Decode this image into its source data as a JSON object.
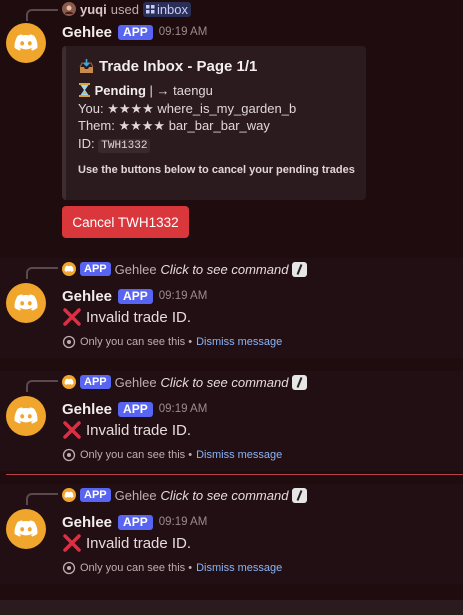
{
  "msg1": {
    "reply_user": "yuqi",
    "reply_action": "used",
    "reply_command": "inbox",
    "author": "Gehlee",
    "badge": "APP",
    "time": "09:19 AM",
    "embed": {
      "title": "Trade Inbox - Page 1/1",
      "status_label": "Pending",
      "status_sep": "| → taengu",
      "you_label": "You:",
      "you_value": "★★★★ where_is_my_garden_b",
      "them_label": "Them:",
      "them_value": "★★★★ bar_bar_bar_way",
      "id_label": "ID:",
      "id_value": "TWH1332",
      "footer": "Use the buttons below to cancel your pending trades"
    },
    "button": "Cancel TWH1332"
  },
  "ephemeral": {
    "reply_badge": "APP",
    "reply_author": "Gehlee",
    "reply_text": "Click to see command",
    "author": "Gehlee",
    "badge": "APP",
    "time": "09:19 AM",
    "content": "Invalid trade ID.",
    "note": "Only you can see this •",
    "dismiss": "Dismiss message"
  },
  "colors": {
    "background": "#1e0c0f",
    "accent": "#5865f2",
    "danger": "#da373c",
    "bot_avatar": "#f0a62c",
    "link": "#8ab4f8"
  },
  "icons": [
    "discord-logo-icon",
    "inbox-tray-icon",
    "hourglass-icon",
    "cross-mark-icon",
    "eye-icon",
    "slash-command-icon"
  ]
}
